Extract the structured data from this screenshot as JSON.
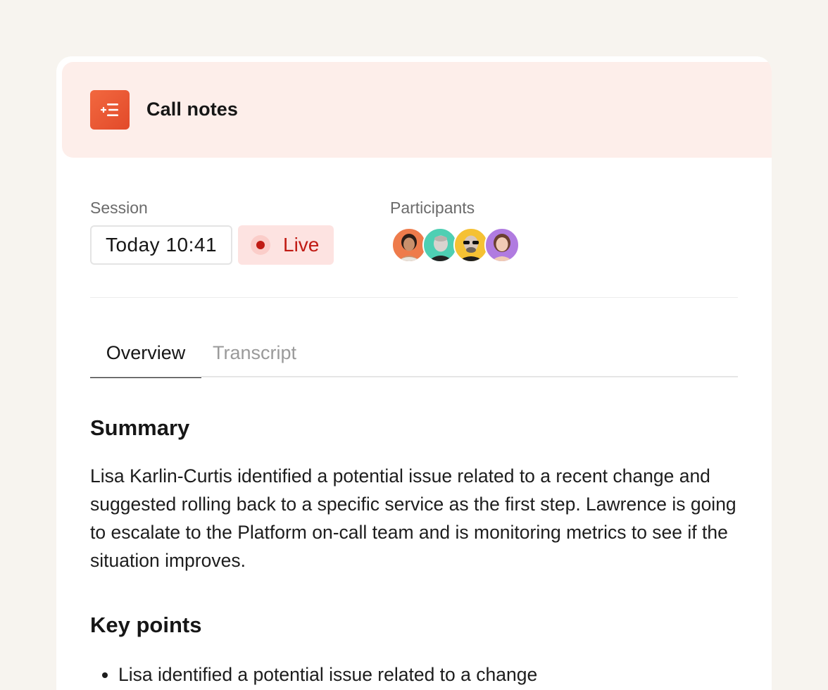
{
  "header": {
    "title": "Call notes",
    "app_icon": "notes-list-icon"
  },
  "session": {
    "label": "Session",
    "time": "Today 10:41",
    "status": "Live",
    "status_color": "#c01b14"
  },
  "participants": {
    "label": "Participants",
    "count": 4
  },
  "tabs": [
    {
      "label": "Overview",
      "active": true
    },
    {
      "label": "Transcript",
      "active": false
    }
  ],
  "summary": {
    "title": "Summary",
    "text": "Lisa Karlin-Curtis identified a potential issue related to a recent change and suggested rolling back to a specific service as the first step. Lawrence is going to escalate to the Platform on-call team and is monitoring metrics to see if the situation improves."
  },
  "key_points": {
    "title": "Key points",
    "items": [
      "Lisa identified a potential issue related to a change"
    ]
  },
  "colors": {
    "accent": "#e8502f",
    "header_bg": "#fdeeea",
    "page_bg": "#f7f4ef"
  }
}
